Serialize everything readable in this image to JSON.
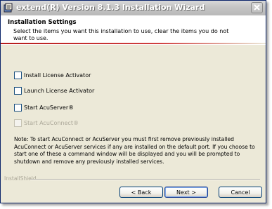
{
  "window": {
    "title": "extend(R) Version 8.1.3 Installation Wizard"
  },
  "header": {
    "title": "Installation Settings",
    "description": "Select the items you want this installation to use, clear the items you do not want to use."
  },
  "options": [
    {
      "label": "Install License Activator",
      "checked": false,
      "enabled": true
    },
    {
      "label": "Launch License Activator",
      "checked": false,
      "enabled": true
    },
    {
      "label": "Start AcuServer®",
      "checked": false,
      "enabled": true
    },
    {
      "label": "Start AcuConnect®",
      "checked": false,
      "enabled": false
    }
  ],
  "note": "Note:  To start AcuConnect or AcuServer you must first remove previously installed AcuConnect or AcuServer services if any are installed on the default port.  If you choose to start one of these a command window will be displayed and you will be prompted to shutdown and remove any previously installed services.",
  "footer": {
    "brand": "InstallShield",
    "back_label": "< Back",
    "next_label": "Next >",
    "cancel_label": "Cancel"
  },
  "colors": {
    "accent_rule": "#b61c1c",
    "dialog_bg": "#ece9d8"
  }
}
